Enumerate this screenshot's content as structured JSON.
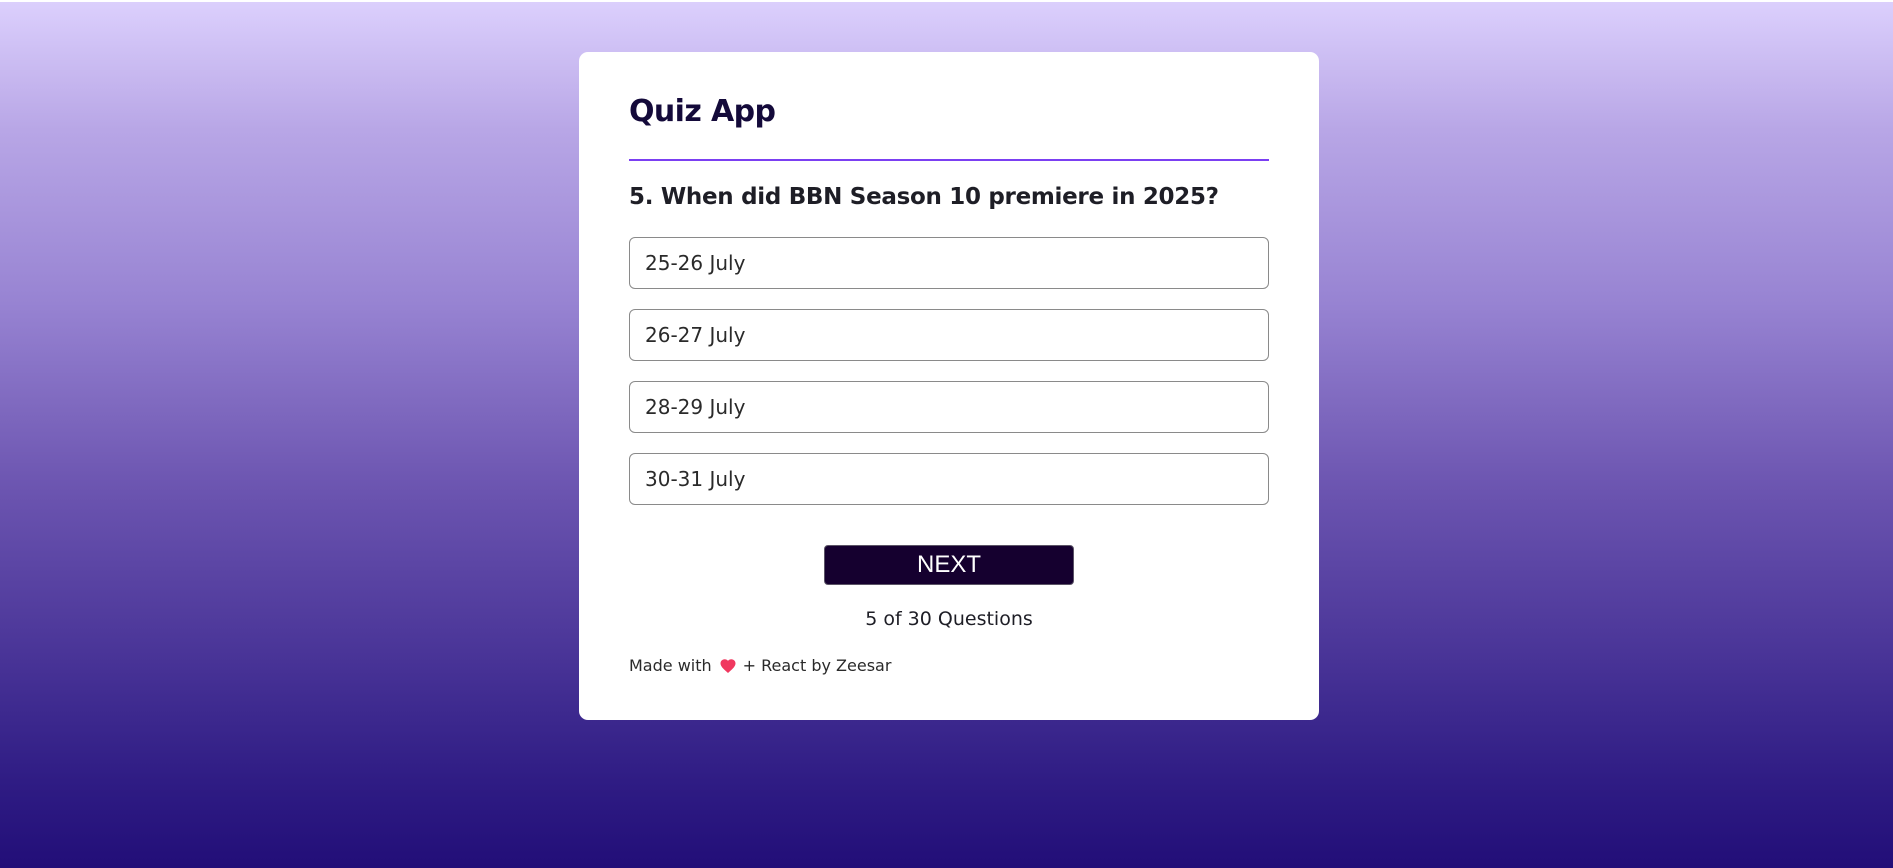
{
  "app": {
    "title": "Quiz App"
  },
  "question": {
    "text": "5. When did BBN Season 10 premiere in 2025?"
  },
  "options": [
    "25-26 July",
    "26-27 July",
    "28-29 July",
    "30-31 July"
  ],
  "actions": {
    "next_label": "NEXT"
  },
  "progress": {
    "text": "5 of 30 Questions",
    "current": 5,
    "total": 30
  },
  "footer": {
    "prefix": "Made with",
    "suffix": "+ React by Zeesar",
    "icon": "heart-icon"
  },
  "colors": {
    "accent": "#7b3ff2",
    "button_bg": "#15002f",
    "heart": "#f0385f"
  }
}
